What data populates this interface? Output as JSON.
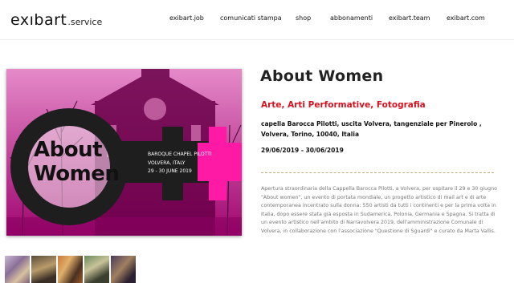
{
  "header": {
    "logo_main": "exıbart",
    "logo_sub": ".service",
    "nav": [
      {
        "label": "exibart.job"
      },
      {
        "label": "comunicati stampa"
      },
      {
        "label": "shop"
      },
      {
        "label": "abbonamenti"
      },
      {
        "label": "exibart.team"
      },
      {
        "label": "exibart.com"
      }
    ]
  },
  "event": {
    "title": "About Women",
    "category": "Arte, Arti Performative, Fotografia",
    "address": "capella Barocca Pilotti, uscita Volvera, tangenziale per Pinerolo , Volvera, Torino, 10040, Italia",
    "dates": "29/06/2019 - 30/06/2019",
    "description": "Apertura straordinaria della Cappella Barocca Pilotti, a Volvera, per ospitare il 29 e 30 giugno \"About women\", un evento di portata mondiale, un progetto artistico di mail art e di arte contemporanea incentrato sulla donna: 550 artisti da tutti i continenti e per la prima volta in Italia, dopo essere stata già esposta in Sudamerica, Polonia, Germania e Spagna. Si tratta di un evento artistico nell'ambito di Narravolvera 2019, dell'amministrazione Comunale di Volvera, in collaborazione con l'associazione \"Questione di Sguardi\" e curato da Marta Vallis."
  },
  "poster": {
    "title_line1": "About",
    "title_line2": "Women",
    "venue_line1": "BAROQUE CHAPEL PILOTTI",
    "venue_line2": "VOLVERA, ITALY",
    "venue_line3": "29 - 30 JUNE 2019"
  },
  "colors": {
    "accent": "#d8101e",
    "poster_magenta": "#b0087d",
    "divider": "#b9b07a"
  }
}
